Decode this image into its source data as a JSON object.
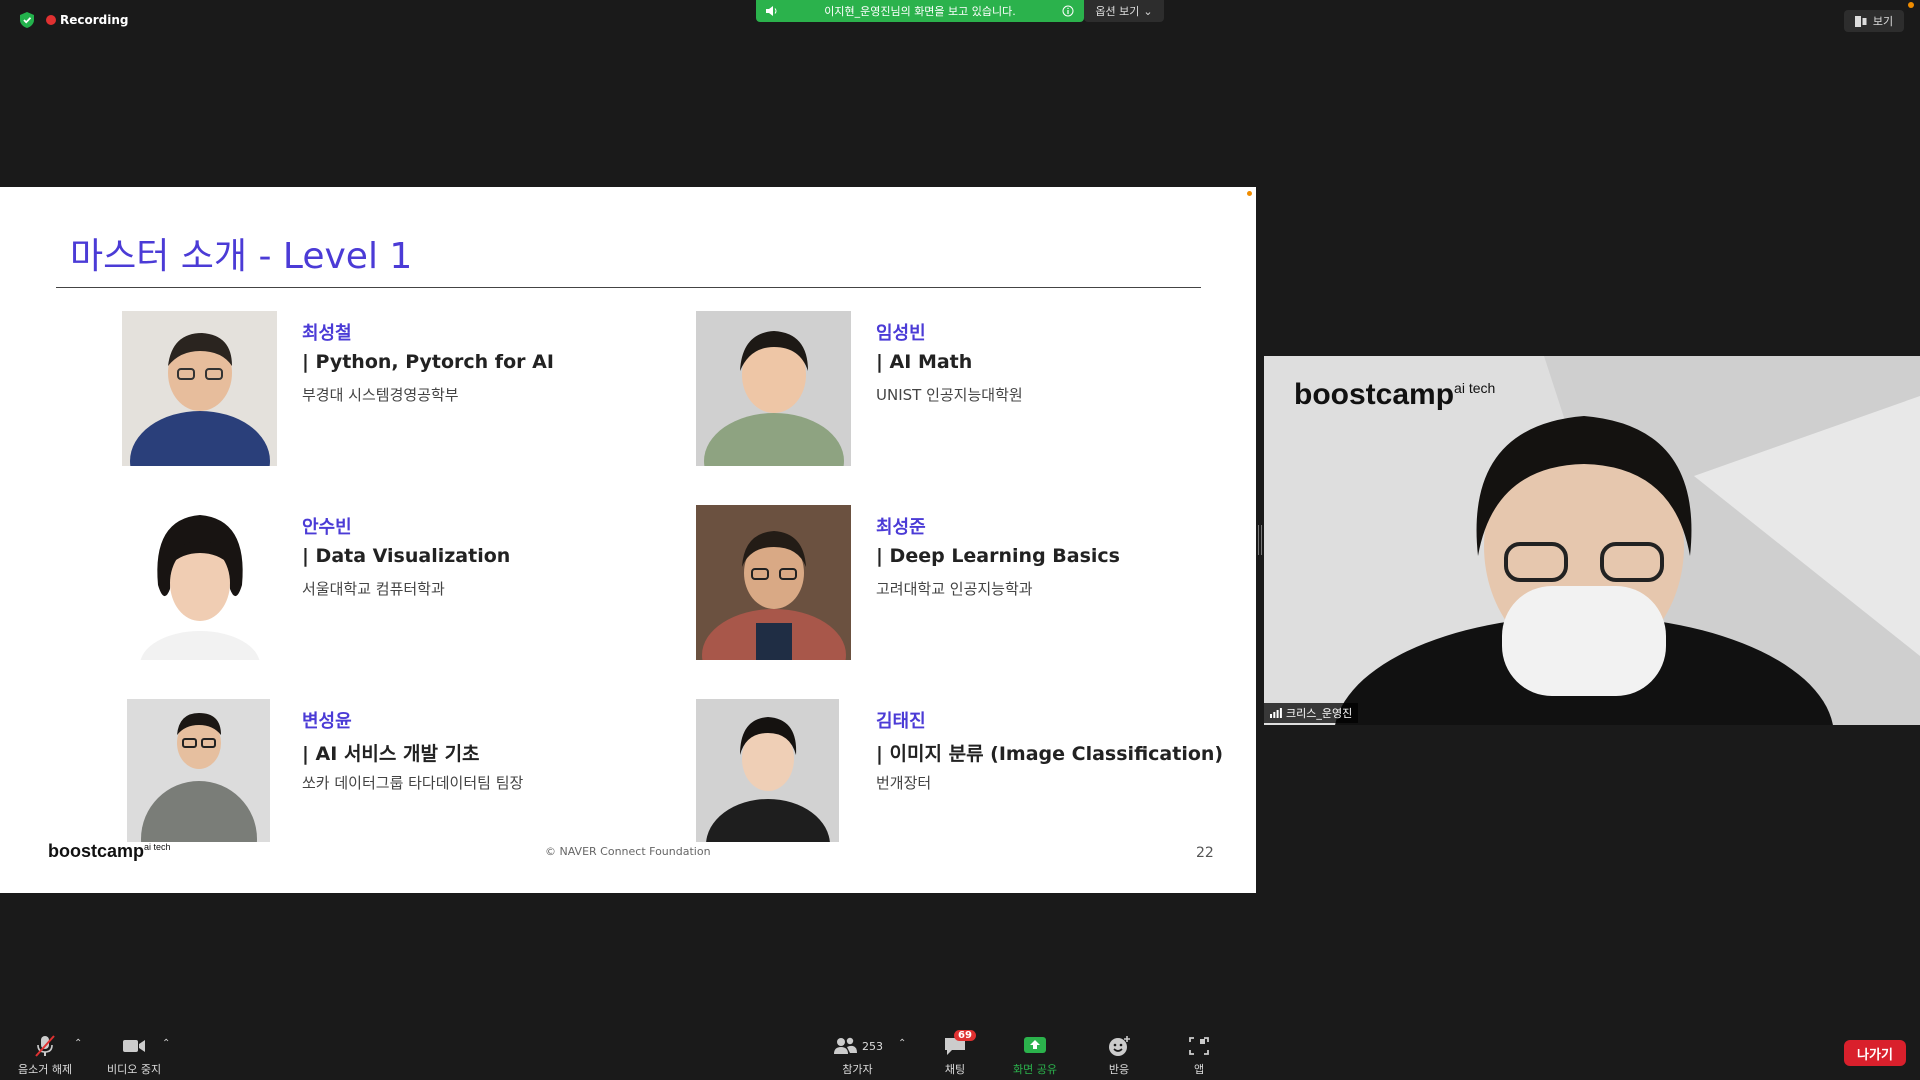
{
  "top": {
    "recording_label": "Recording",
    "share_banner_text": "이지현_운영진님의 화면을 보고 있습니다.",
    "view_options_label": "옵션 보기",
    "view_button_label": "보기"
  },
  "slide": {
    "title": "마스터 소개 - Level 1",
    "people": [
      {
        "name": "최성철",
        "subject": "| Python, Pytorch for AI",
        "affiliation": "부경대 시스템경영공학부"
      },
      {
        "name": "임성빈",
        "subject": "| AI Math",
        "affiliation": "UNIST 인공지능대학원"
      },
      {
        "name": "안수빈",
        "subject": "| Data Visualization",
        "affiliation": "서울대학교 컴퓨터학과"
      },
      {
        "name": "최성준",
        "subject": "| Deep Learning Basics",
        "affiliation": "고려대학교 인공지능학과"
      },
      {
        "name": "변성윤",
        "subject": "| AI 서비스 개발 기초",
        "affiliation": "쏘카 데이터그룹 타다데이터팀 팀장"
      },
      {
        "name": "김태진",
        "subject": "| 이미지 분류 (Image Classification)",
        "affiliation": "번개장터"
      }
    ],
    "footer_logo": "boostcamp",
    "footer_logo_sup": "ai tech",
    "copyright": "©  NAVER Connect Foundation",
    "page_number": "22"
  },
  "camera": {
    "logo": "boostcamp",
    "logo_sup": "ai tech",
    "participant_name": "크리스_운영진"
  },
  "toolbar": {
    "mute_label": "음소거 해제",
    "video_label": "비디오 중지",
    "participants_label": "참가자",
    "participants_count": "253",
    "chat_label": "채팅",
    "chat_badge": "69",
    "share_label": "화면 공유",
    "reactions_label": "반응",
    "apps_label": "앱",
    "leave_label": "나가기"
  },
  "colors": {
    "share_green": "#2bb24c",
    "title_blue": "#4b3bd6",
    "leave_red": "#d9202c"
  }
}
